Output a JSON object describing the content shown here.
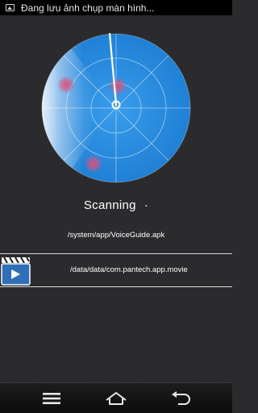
{
  "status_bar": {
    "icon": "image-icon",
    "notification_text": "Đang lưu ảnh chụp màn hình..."
  },
  "radar": {
    "colors": {
      "sweep_light": "#ffffff",
      "disc": "#2f8fe0",
      "disc_edge": "#1e78d0",
      "ring": "#ffffff",
      "blip": "#e0507a"
    }
  },
  "scan": {
    "status_text": "Scanning",
    "progress_dot": "·",
    "current_file": "/system/app/VoiceGuide.apk"
  },
  "result": {
    "icon": "movie-clapper-icon",
    "path": "/data/data/com.pantech.app.movie"
  },
  "nav": {
    "menu_icon": "menu-icon",
    "home_icon": "home-icon",
    "back_icon": "back-icon"
  }
}
